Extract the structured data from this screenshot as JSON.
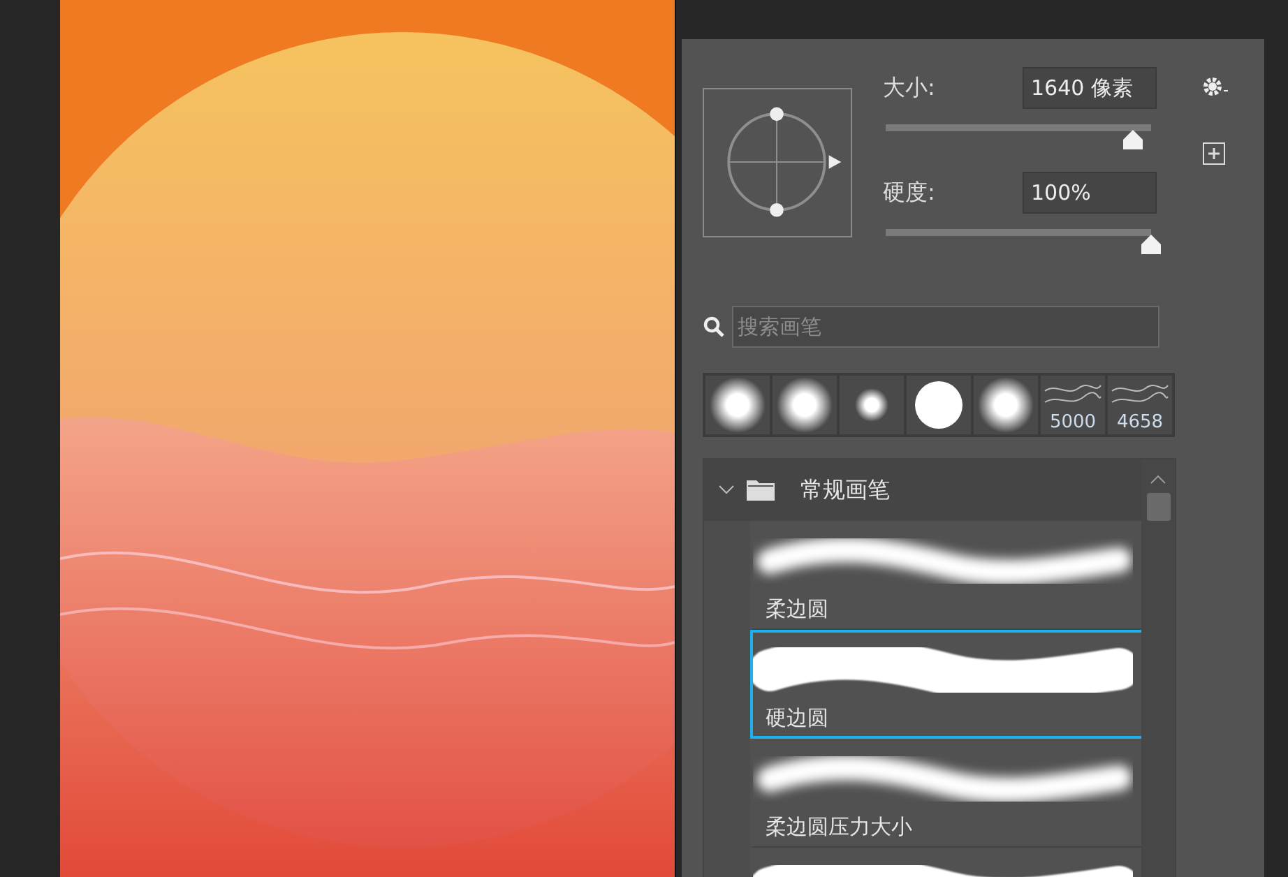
{
  "controls": [
    {
      "label": "大小:",
      "value": "1640 像素",
      "level": 0.93
    },
    {
      "label": "硬度:",
      "value": "100%",
      "level": 1.0
    }
  ],
  "search": {
    "placeholder": "搜索画笔"
  },
  "recent_brushes": [
    {
      "kind": "soft"
    },
    {
      "kind": "soft"
    },
    {
      "kind": "small"
    },
    {
      "kind": "hard"
    },
    {
      "kind": "soft"
    },
    {
      "kind": "texture",
      "count": "5000"
    },
    {
      "kind": "texture",
      "count": "4658"
    }
  ],
  "brush_group": {
    "name": "常规画笔",
    "expanded": true,
    "brushes": [
      {
        "name": "柔边圆",
        "kind": "soft",
        "selected": false
      },
      {
        "name": "硬边圆",
        "kind": "hard",
        "selected": true
      },
      {
        "name": "柔边圆压力大小",
        "kind": "soft",
        "selected": false
      },
      {
        "kind": "hard",
        "selected": false
      }
    ]
  }
}
